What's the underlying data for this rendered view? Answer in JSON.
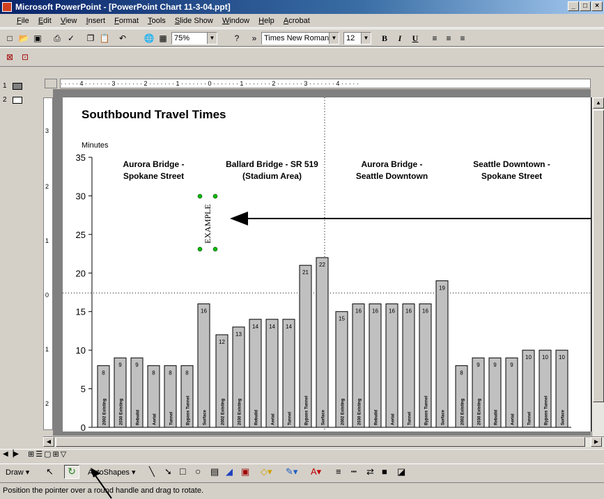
{
  "window": {
    "title": "Microsoft PowerPoint - [PowerPoint Chart 11-3-04.ppt]",
    "controls": [
      "_",
      "□",
      "×"
    ]
  },
  "menu": [
    "File",
    "Edit",
    "View",
    "Insert",
    "Format",
    "Tools",
    "Slide Show",
    "Window",
    "Help",
    "Acrobat"
  ],
  "toolbar": {
    "zoom": "75%",
    "font_name": "Times New Roman",
    "font_size": "12",
    "bold": "B",
    "italic": "I",
    "underline": "U"
  },
  "slides_panel": [
    "1",
    "2"
  ],
  "ruler": {
    "horizontal": "· · · · · 4 · · · · · · · 3 · · · · · · · 2 · · · · · · · 1 · · · · · · · 0 · · · · · · · 1 · · · · · · · 2 · · · · · · · 3 · · · · · · · 4 · · · · ·",
    "vertical": [
      "3",
      "2",
      "1",
      "0",
      "1",
      "2"
    ]
  },
  "slide": {
    "textbox": "EXAMPLE"
  },
  "chart_data": {
    "type": "bar",
    "title": "Southbound Travel Times",
    "ylabel": "Minutes",
    "ylim": [
      0,
      35
    ],
    "yticks": [
      0,
      5,
      10,
      15,
      20,
      25,
      30,
      35
    ],
    "groups": [
      {
        "label": [
          "Aurora Bridge -",
          "Spokane Street"
        ],
        "categories": [
          "2002 Existing",
          "2030 Existing",
          "Rebuild",
          "Aerial",
          "Tunnel",
          "Bypass Tunnel",
          "Surface"
        ],
        "values": [
          8,
          9,
          9,
          8,
          8,
          8,
          16
        ]
      },
      {
        "label": [
          "Ballard Bridge - SR 519",
          "(Stadium Area)"
        ],
        "categories": [
          "2002 Existing",
          "2030 Existing",
          "Rebuild",
          "Aerial",
          "Tunnel",
          "Bypass Tunnel",
          "Surface"
        ],
        "values": [
          12,
          13,
          14,
          14,
          14,
          21,
          22
        ]
      },
      {
        "label": [
          "Aurora Bridge -",
          "Seattle Downtown"
        ],
        "categories": [
          "2002 Existing",
          "2030 Existing",
          "Rebuild",
          "Aerial",
          "Tunnel",
          "Bypass Tunnel",
          "Surface"
        ],
        "values": [
          15,
          16,
          16,
          16,
          16,
          16,
          19
        ]
      },
      {
        "label": [
          "Seattle Downtown -",
          "Spokane Street"
        ],
        "categories": [
          "2002 Existing",
          "2030 Existing",
          "Rebuild",
          "Aerial",
          "Tunnel",
          "Bypass Tunnel",
          "Surface"
        ],
        "values": [
          8,
          9,
          9,
          9,
          10,
          10,
          10
        ]
      }
    ],
    "bar_color": "#c0c0c0"
  },
  "draw_toolbar": {
    "draw": "Draw",
    "autoshapes": "AutoShapes"
  },
  "status": "Position the pointer over a round handle and drag to rotate."
}
